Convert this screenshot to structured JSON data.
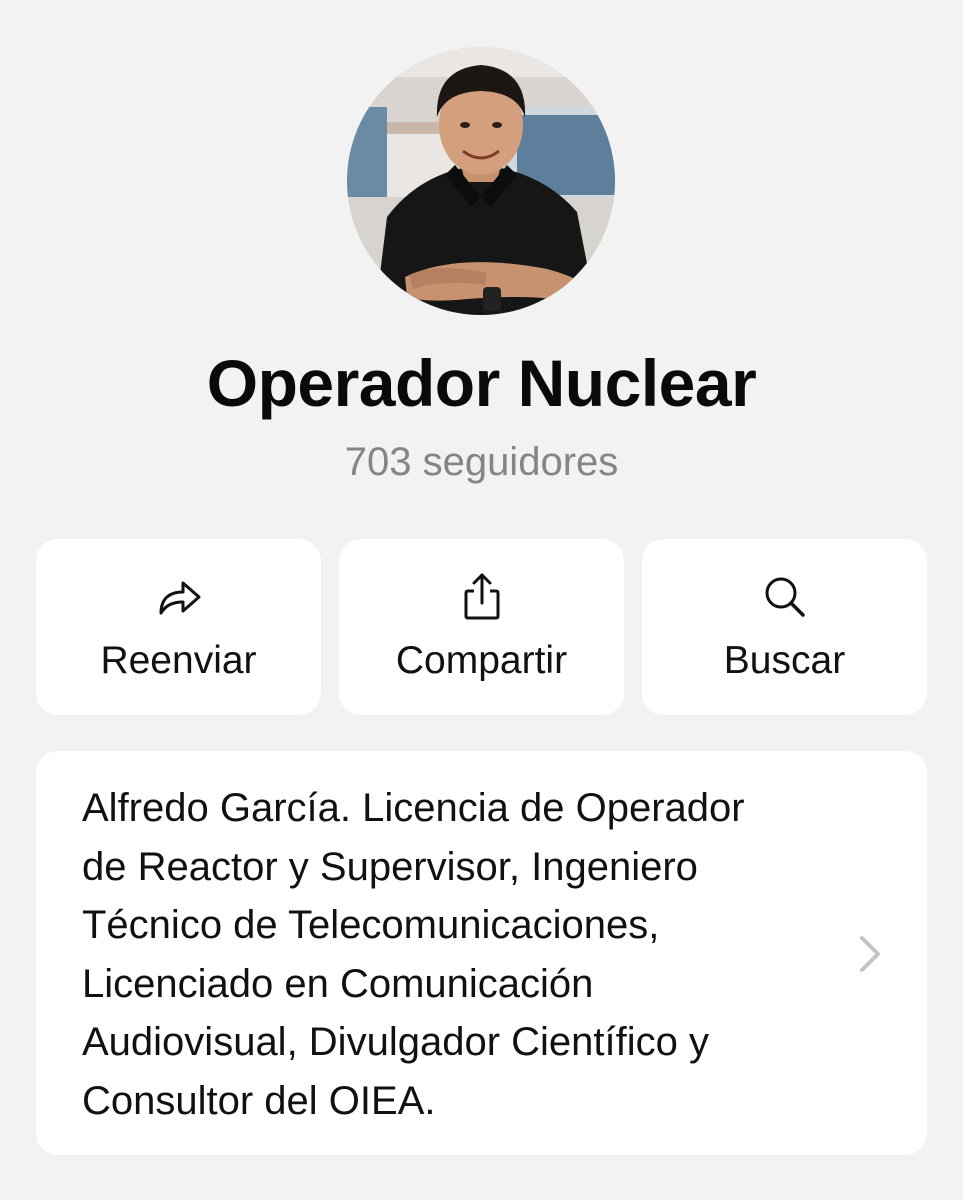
{
  "channel": {
    "name": "Operador Nuclear",
    "followers": "703 seguidores"
  },
  "avatar": {
    "icon": "profile-photo"
  },
  "actions": [
    {
      "label": "Reenviar",
      "icon": "forward-arrow-icon"
    },
    {
      "label": "Compartir",
      "icon": "share-icon"
    },
    {
      "label": "Buscar",
      "icon": "search-icon"
    }
  ],
  "about": {
    "lines": [
      "Alfredo García. Licencia de Operador",
      "de Reactor y Supervisor, Ingeniero",
      "Técnico de Telecomunicaciones,",
      "Licenciado en Comunicación",
      "Audiovisual, Divulgador Científico y",
      "Consultor del OIEA."
    ],
    "chevron_icon": "chevron-right-icon"
  },
  "colors": {
    "background": "#f2f2f2",
    "card": "#ffffff",
    "secondary_text": "#858585",
    "chevron": "#c4c4c6"
  }
}
